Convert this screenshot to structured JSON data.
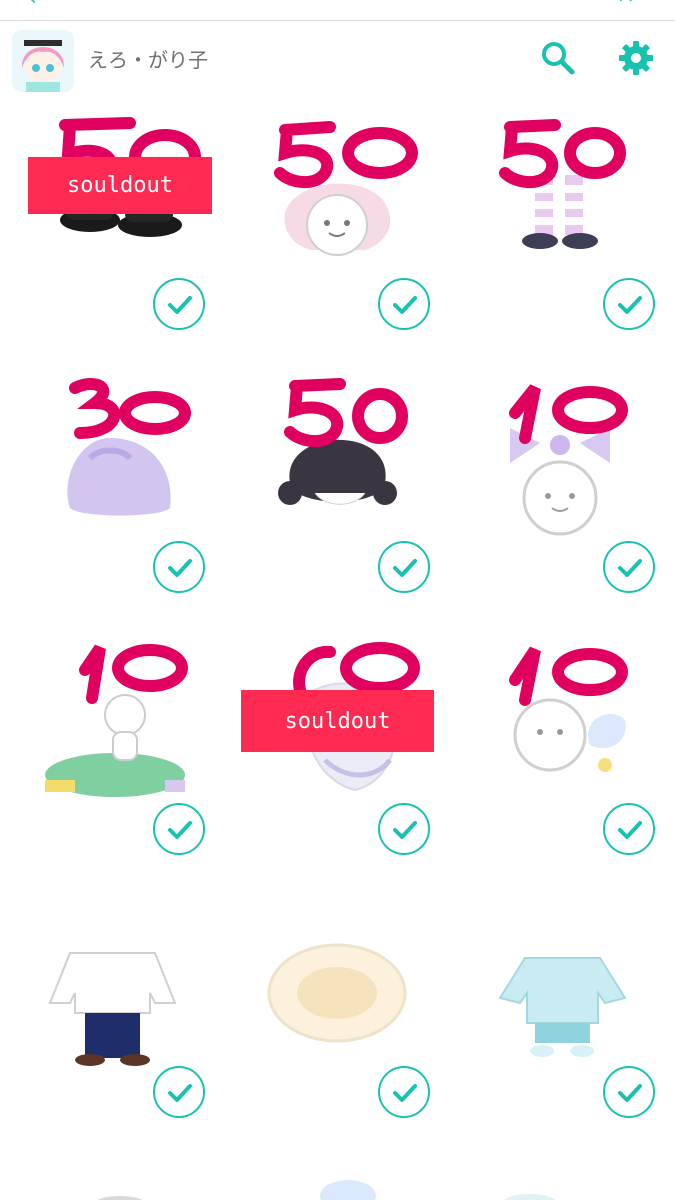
{
  "app": {
    "username": "えろ・がり子",
    "avatar_icon": "user-avatar-icon",
    "accent_color": "#19c2b0"
  },
  "toolbar": {
    "search_icon": "search-icon",
    "settings_icon": "gear-icon"
  },
  "items": [
    {
      "name": "black-shoes",
      "price": "50",
      "soldout": "souldout"
    },
    {
      "name": "pastel-bob-hair",
      "price": "50"
    },
    {
      "name": "striped-socks",
      "price": "50"
    },
    {
      "name": "lavender-fluffy-coat",
      "price": "30"
    },
    {
      "name": "black-ponytail-hair",
      "price": "50"
    },
    {
      "name": "lavender-ribbon",
      "price": "10"
    },
    {
      "name": "green-rug-set",
      "price": "10"
    },
    {
      "name": "angel-wing-item",
      "price": "10",
      "soldout": "souldout"
    },
    {
      "name": "feather-hair-clip",
      "price": "10"
    },
    {
      "name": "sweater-outfit",
      "price": ""
    },
    {
      "name": "fur-stole",
      "price": ""
    },
    {
      "name": "blue-set-outfit",
      "price": ""
    }
  ],
  "colors": {
    "soldout_bg": "#ff2a52",
    "price_ink": "#e0005f",
    "check_color": "#19c2b0"
  }
}
